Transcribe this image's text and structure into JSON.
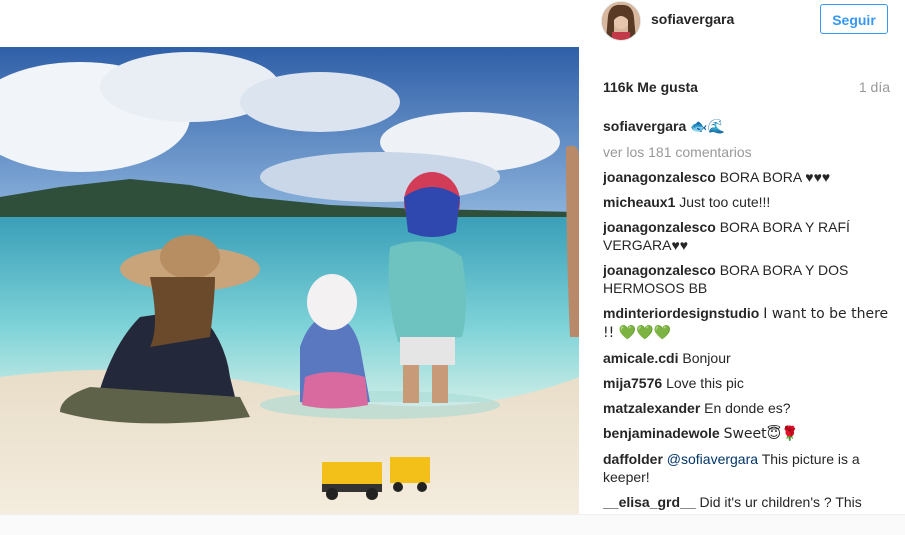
{
  "post": {
    "username": "sofiavergara",
    "follow_label": "Seguir",
    "likes": "116k Me gusta",
    "time": "1 día",
    "caption_user": "sofiavergara",
    "caption_text": "🐟🌊",
    "view_comments": "ver los 181 comentarios"
  },
  "comments": [
    {
      "user": "joanagonzalesco",
      "text": "BORA BORA ♥♥♥"
    },
    {
      "user": "micheaux1",
      "text": "Just too cute!!!"
    },
    {
      "user": "joanagonzalesco",
      "text": "BORA BORA Y RAFÍ VERGARA♥♥"
    },
    {
      "user": "joanagonzalesco",
      "text": "BORA BORA Y DOS HERMOSOS BB"
    },
    {
      "user": "mdinteriordesignstudio",
      "text": "I want to be there !! 💚💚💚"
    },
    {
      "user": "amicale.cdi",
      "text": "Bonjour"
    },
    {
      "user": "mija7576",
      "text": "Love this pic"
    },
    {
      "user": "matzalexander",
      "text": "En donde es?"
    },
    {
      "user": "benjaminadewole",
      "text": "Sweet😇🌹"
    },
    {
      "user": "daffolder",
      "mention": "@sofiavergara",
      "text": "This picture is a keeper!"
    },
    {
      "user": "__elisa_grd__",
      "text": "Did it's ur children's ? This place is beautiful!♥♥"
    }
  ]
}
